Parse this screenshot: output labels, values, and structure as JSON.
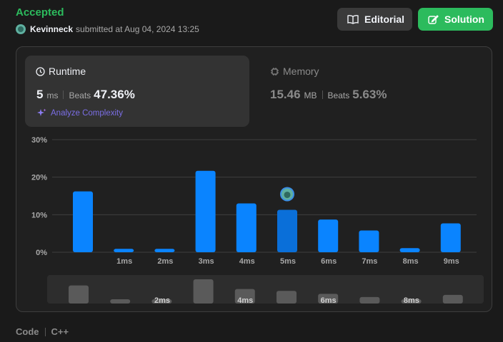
{
  "submission": {
    "status": "Accepted",
    "username": "Kevinneck",
    "submitted_text": "submitted at Aug 04, 2024 13:25"
  },
  "actions": {
    "editorial_label": "Editorial",
    "solution_label": "Solution"
  },
  "runtime": {
    "title": "Runtime",
    "value": "5",
    "unit": "ms",
    "beats_label": "Beats",
    "beats": "47.36%",
    "analyze_label": "Analyze Complexity"
  },
  "memory": {
    "title": "Memory",
    "value": "15.46",
    "unit": "MB",
    "beats_label": "Beats",
    "beats": "5.63%"
  },
  "chart_data": {
    "type": "bar",
    "y_ticks": [
      "30%",
      "20%",
      "10%",
      "0%"
    ],
    "ylim": [
      0,
      30
    ],
    "categories": [
      "",
      "1ms",
      "2ms",
      "3ms",
      "4ms",
      "5ms",
      "6ms",
      "7ms",
      "8ms",
      "9ms"
    ],
    "values": [
      16.2,
      0.9,
      0.9,
      21.7,
      13.0,
      11.3,
      8.7,
      5.8,
      1.1,
      7.7
    ],
    "highlight_index": 5,
    "bar_color": "#0a84ff",
    "highlight_color": "#0a6fd9",
    "minimap_labels": [
      "2ms",
      "4ms",
      "6ms",
      "8ms"
    ]
  },
  "footer": {
    "code_label": "Code",
    "language": "C++"
  }
}
